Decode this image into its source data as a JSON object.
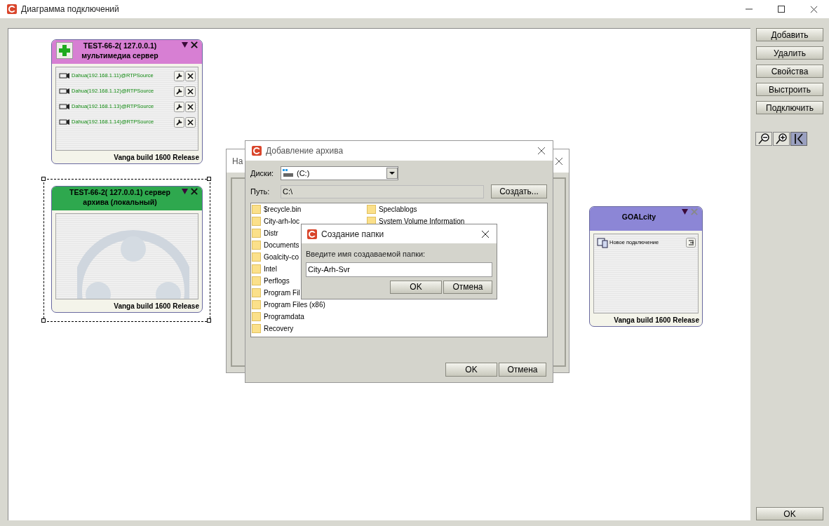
{
  "window": {
    "title": "Диаграмма подключений"
  },
  "nodes": [
    {
      "kind": "media",
      "title_lines": [
        "TEST-66-2( 127.0.0.1)",
        "мультимедиа сервер"
      ],
      "color": "#d77fd3",
      "selected": false,
      "items": [
        {
          "label": "Dahua(192.168.1.11)@RTPSource"
        },
        {
          "label": "Dahua(192.168.1.12)@RTPSource"
        },
        {
          "label": "Dahua(192.168.1.13)@RTPSource"
        },
        {
          "label": "Dahua(192.168.1.14)@RTPSource"
        }
      ],
      "footer": "Vanga build  1600 Release"
    },
    {
      "kind": "archive",
      "title_lines": [
        "TEST-66-2( 127.0.0.1) сервер",
        "архива (локальный)"
      ],
      "color": "#2ea84e",
      "selected": true,
      "footer": "Vanga build  1600 Release"
    },
    {
      "kind": "client",
      "title_lines": [
        "GOALcity"
      ],
      "color": "#8c86d6",
      "selected": false,
      "items": [
        {
          "label": "Новое подключение"
        }
      ],
      "footer": "Vanga build  1600 Release"
    }
  ],
  "back_dialog": {
    "title": "На"
  },
  "archive_dialog": {
    "title": "Добавление архива",
    "drives_label": "Диски:",
    "drive": "(C:)",
    "path_label": "Путь:",
    "path": "C:\\",
    "create_button": "Создать...",
    "folders": [
      "$recycle.bin",
      "City-arh-loc",
      "Distr",
      "Documents",
      "Goalcity-co",
      "Intel",
      "Perflogs",
      "Program Fil",
      "Program Files (x86)",
      "Programdata",
      "Recovery",
      "Speclablogs",
      "System Volume Information"
    ],
    "ok_button": "OK",
    "cancel_button": "Отмена"
  },
  "new_folder_dialog": {
    "title": "Создание папки",
    "prompt": "Введите имя создаваемой папки:",
    "value": "City-Arh-Svr",
    "ok_button": "OK",
    "cancel_button": "Отмена"
  },
  "side_buttons": [
    "Добавить",
    "Удалить",
    "Свойства",
    "Выстроить",
    "Подключить"
  ],
  "ok_button": "OK"
}
